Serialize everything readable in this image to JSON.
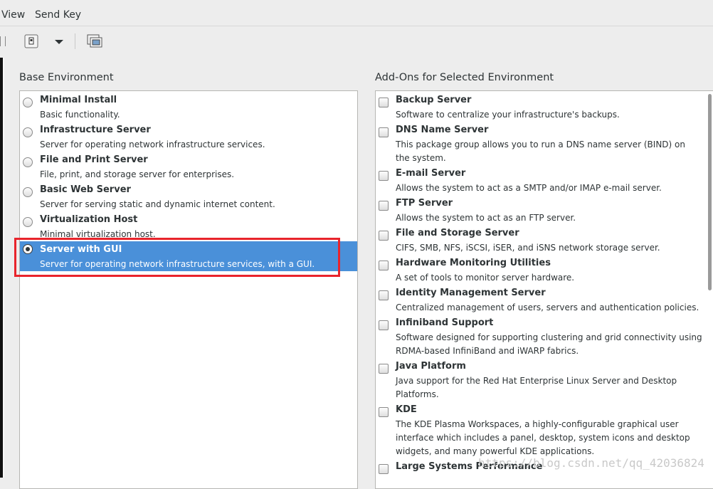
{
  "menu": {
    "view": "View",
    "send_key": "Send Key"
  },
  "base_environment": {
    "title": "Base Environment",
    "items": [
      {
        "label": "Minimal Install",
        "desc": "Basic functionality."
      },
      {
        "label": "Infrastructure Server",
        "desc": "Server for operating network infrastructure services."
      },
      {
        "label": "File and Print Server",
        "desc": "File, print, and storage server for enterprises."
      },
      {
        "label": "Basic Web Server",
        "desc": "Server for serving static and dynamic internet content."
      },
      {
        "label": "Virtualization Host",
        "desc": "Minimal virtualization host."
      },
      {
        "label": "Server with GUI",
        "desc": "Server for operating network infrastructure services, with a GUI."
      }
    ]
  },
  "addons": {
    "title": "Add-Ons for Selected Environment",
    "items": [
      {
        "label": "Backup Server",
        "desc1": "Software to centralize your infrastructure's backups."
      },
      {
        "label": "DNS Name Server",
        "desc1": "This package group allows you to run a DNS name server (BIND) on",
        "desc2": "the system."
      },
      {
        "label": "E-mail Server",
        "desc1": "Allows the system to act as a SMTP and/or IMAP e-mail server."
      },
      {
        "label": "FTP Server",
        "desc1": "Allows the system to act as an FTP server."
      },
      {
        "label": "File and Storage Server",
        "desc1": "CIFS, SMB, NFS, iSCSI, iSER, and iSNS network storage server."
      },
      {
        "label": "Hardware Monitoring Utilities",
        "desc1": "A set of tools to monitor server hardware."
      },
      {
        "label": "Identity Management Server",
        "desc1": "Centralized management of users, servers and authentication policies."
      },
      {
        "label": "Infiniband Support",
        "desc1": "Software designed for supporting clustering and grid connectivity using",
        "desc2": "RDMA-based InfiniBand and iWARP fabrics."
      },
      {
        "label": "Java Platform",
        "desc1": "Java support for the Red Hat Enterprise Linux Server and Desktop",
        "desc2": "Platforms."
      },
      {
        "label": "KDE",
        "desc1": "The KDE Plasma Workspaces, a highly-configurable graphical user",
        "desc2": "interface which includes a panel, desktop, system icons and desktop",
        "desc3": "widgets, and many powerful KDE applications."
      },
      {
        "label": "Large Systems Performance"
      }
    ]
  },
  "watermark": "https://blog.csdn.net/qq_42036824",
  "colors": {
    "selection": "#4a90d9",
    "highlight_box": "#e8242c"
  },
  "icons": [
    "pause-icon",
    "usb-device-icon",
    "dropdown-arrow-icon",
    "screenshot-icon"
  ]
}
